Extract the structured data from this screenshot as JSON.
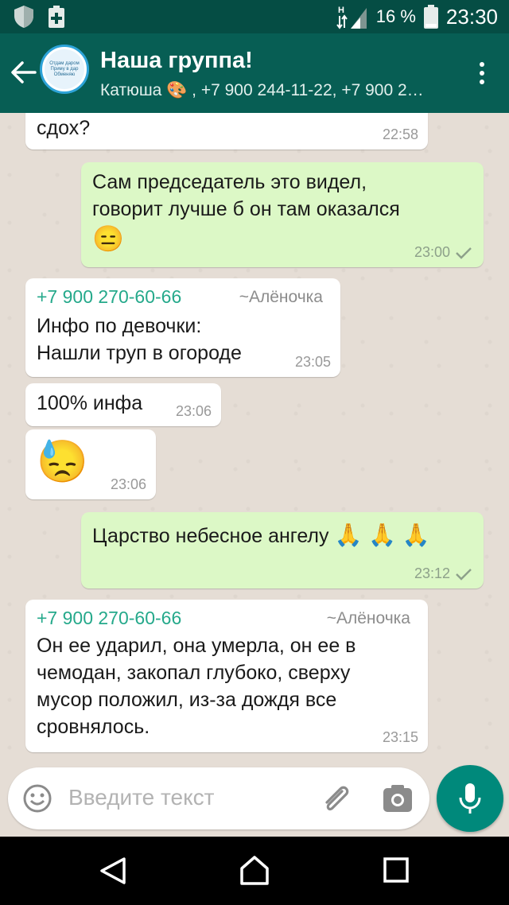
{
  "status_bar": {
    "battery_percent": "16 %",
    "time": "23:30",
    "icons": [
      "shield-icon",
      "clipboard-plus-icon",
      "network-h-icon",
      "signal-icon",
      "battery-icon"
    ]
  },
  "header": {
    "title": "Наша группа!",
    "subtitle": "Катюша 🎨 , +7 900 244-11-22, +7 900 2…",
    "avatar_text": [
      "Отдам даром",
      "Приму в дар",
      "Обменяю"
    ]
  },
  "messages": [
    {
      "direction": "in",
      "lines": [
        "сдох?"
      ],
      "time": "22:58"
    },
    {
      "direction": "out",
      "lines": [
        "Сам председатель это видел,",
        "говорит лучше б он там оказался"
      ],
      "emoji": "😑",
      "time": "23:00"
    },
    {
      "direction": "in",
      "sender": "+7 900 270-60-66",
      "sender_name": "~Алёночка",
      "lines": [
        "Инфо по девочки:",
        "Нашли труп в огороде"
      ],
      "time": "23:05"
    },
    {
      "direction": "in",
      "lines": [
        "100% инфа"
      ],
      "time": "23:06"
    },
    {
      "direction": "in",
      "emoji": "😓",
      "time": "23:06"
    },
    {
      "direction": "out",
      "lines": [
        "Царство небесное ангелу"
      ],
      "emoji": "🙏 🙏 🙏",
      "time": "23:12"
    },
    {
      "direction": "in",
      "sender": "+7 900 270-60-66",
      "sender_name": "~Алёночка",
      "lines": [
        "Он ее ударил, она умерла, он ее в",
        "чемодан, закопал глубоко, сверху",
        "мусор положил, из-за дождя все",
        "сровнялось."
      ],
      "time": "23:15"
    }
  ],
  "composer": {
    "placeholder": "Введите текст"
  },
  "colors": {
    "header": "#075e54",
    "status_bar": "#054d44",
    "outgoing_bubble": "#dcf8c6",
    "incoming_bubble": "#ffffff",
    "sender": "#25a98b",
    "mic_button": "#00897b"
  }
}
